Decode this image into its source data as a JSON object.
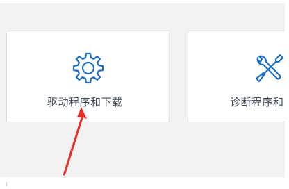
{
  "cards": [
    {
      "label": "驱动程序和下载",
      "icon": "gear-icon"
    },
    {
      "label": "诊断程序和",
      "icon": "wrench-screwdriver-icon"
    }
  ],
  "colors": {
    "icon": "#1a6cc4",
    "label_text": "#3f4c5a",
    "arrow": "#e8312b",
    "page_bg": "#f2f2f2",
    "card_bg": "#ffffff",
    "card_border": "#e1e1e1"
  },
  "annotation": {
    "icon": "red-arrow-annotation"
  }
}
